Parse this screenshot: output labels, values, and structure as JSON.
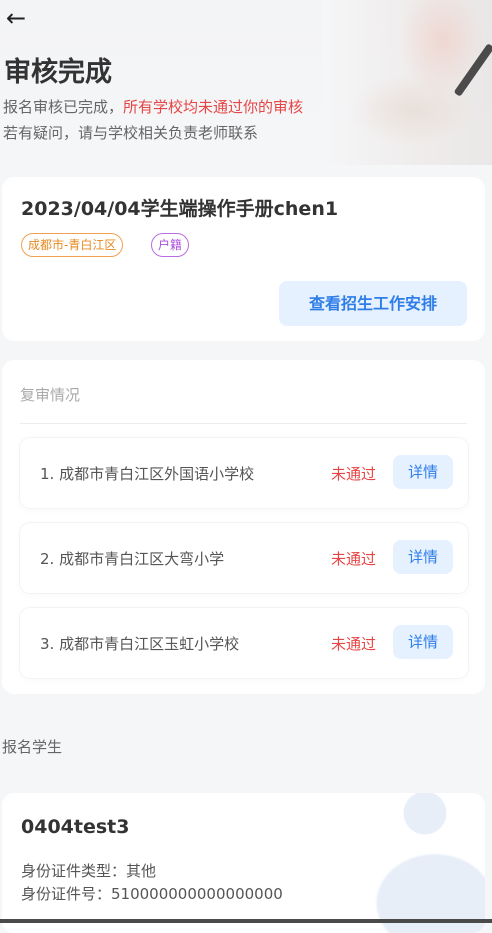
{
  "header": {
    "back_glyph": "←",
    "title": "审核完成",
    "subtitle_prefix": "报名审核已完成，",
    "subtitle_highlight": "所有学校均未通过你的审核",
    "subtitle_line2": "若有疑问，请与学校相关负责老师联系"
  },
  "application": {
    "title": "2023/04/04学生端操作手册chen1",
    "tags": [
      "成都市-青白江区",
      "户籍"
    ],
    "button_label": "查看招生工作安排"
  },
  "review": {
    "section_label": "复审情况",
    "rows": [
      {
        "name": "1. 成都市青白江区外国语小学校",
        "status": "未通过",
        "action": "详情"
      },
      {
        "name": "2. 成都市青白江区大弯小学",
        "status": "未通过",
        "action": "详情"
      },
      {
        "name": "3. 成都市青白江区玉虹小学校",
        "status": "未通过",
        "action": "详情"
      }
    ]
  },
  "students": {
    "section_label": "报名学生",
    "name": "0404test3",
    "id_type_line": "身份证件类型：其他",
    "id_number_line": "身份证件号：510000000000000000"
  },
  "colors": {
    "accent_blue": "#2f7ee8",
    "fail_red": "#e64545",
    "tag_orange": "#e68a20",
    "tag_purple": "#a94fd8"
  }
}
